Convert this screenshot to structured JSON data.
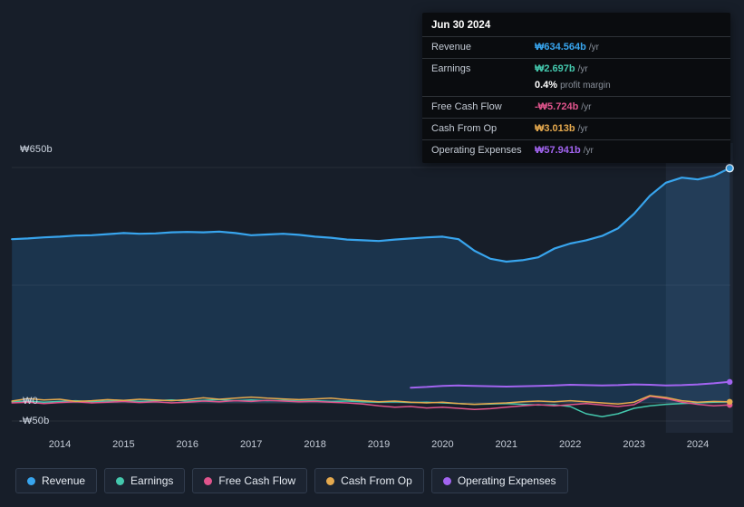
{
  "colors": {
    "revenue": "#38a5ee",
    "earnings": "#44c8ad",
    "free_cash_flow": "#e0548c",
    "cash_from_op": "#e5a94e",
    "operating_expenses": "#a264f0",
    "background": "#171e29",
    "tooltip_bg": "#0a0c0f",
    "grid": "#2a3342"
  },
  "tooltip": {
    "date": "Jun 30 2024",
    "per_year": "/yr",
    "revenue": {
      "label": "Revenue",
      "value": "₩634.564b"
    },
    "earnings": {
      "label": "Earnings",
      "value": "₩2.697b"
    },
    "profit_margin": {
      "value": "0.4%",
      "label": "profit margin"
    },
    "free_cash_flow": {
      "label": "Free Cash Flow",
      "value": "-₩5.724b"
    },
    "cash_from_op": {
      "label": "Cash From Op",
      "value": "₩3.013b"
    },
    "operating_expenses": {
      "label": "Operating Expenses",
      "value": "₩57.941b"
    }
  },
  "axis": {
    "y650": "₩650b",
    "y0": "₩0",
    "yneg50": "-₩50b",
    "x_ticks": [
      {
        "label": "2014",
        "year": 2014
      },
      {
        "label": "2015",
        "year": 2015
      },
      {
        "label": "2016",
        "year": 2016
      },
      {
        "label": "2017",
        "year": 2017
      },
      {
        "label": "2018",
        "year": 2018
      },
      {
        "label": "2019",
        "year": 2019
      },
      {
        "label": "2020",
        "year": 2020
      },
      {
        "label": "2021",
        "year": 2021
      },
      {
        "label": "2022",
        "year": 2022
      },
      {
        "label": "2023",
        "year": 2023
      },
      {
        "label": "2024",
        "year": 2024
      }
    ]
  },
  "legend": [
    {
      "key": "revenue",
      "label": "Revenue"
    },
    {
      "key": "earnings",
      "label": "Earnings"
    },
    {
      "key": "free_cash_flow",
      "label": "Free Cash Flow"
    },
    {
      "key": "cash_from_op",
      "label": "Cash From Op"
    },
    {
      "key": "operating_expenses",
      "label": "Operating Expenses"
    }
  ],
  "chart_data": {
    "type": "area",
    "title": "Revenue & expenses history (KRW billions)",
    "unit": "₩b",
    "ylim": [
      -60,
      680
    ],
    "grid_lines": [
      650,
      325,
      0,
      -50
    ],
    "highlight_from": 2023.5,
    "highlight_to": 2024.55,
    "x": [
      2013.25,
      2013.5,
      2013.75,
      2014,
      2014.25,
      2014.5,
      2014.75,
      2015,
      2015.25,
      2015.5,
      2015.75,
      2016,
      2016.25,
      2016.5,
      2016.75,
      2017,
      2017.25,
      2017.5,
      2017.75,
      2018,
      2018.25,
      2018.5,
      2018.75,
      2019,
      2019.25,
      2019.5,
      2019.75,
      2020,
      2020.25,
      2020.5,
      2020.75,
      2021,
      2021.25,
      2021.5,
      2021.75,
      2022,
      2022.25,
      2022.5,
      2022.75,
      2023,
      2023.25,
      2023.5,
      2023.75,
      2024,
      2024.25,
      2024.5
    ],
    "series": [
      {
        "key": "revenue",
        "name": "Revenue",
        "last_value": 634.564,
        "values": [
          452,
          454,
          457,
          459,
          462,
          463,
          466,
          469,
          467,
          468,
          471,
          472,
          471,
          473,
          469,
          463,
          465,
          467,
          464,
          459,
          456,
          451,
          449,
          447,
          451,
          454,
          457,
          459,
          452,
          420,
          398,
          390,
          394,
          402,
          426,
          440,
          449,
          461,
          482,
          522,
          572,
          608,
          622,
          617,
          627,
          648
        ]
      },
      {
        "key": "earnings",
        "name": "Earnings",
        "last_value": 2.697,
        "values": [
          3,
          5,
          2,
          4,
          6,
          3,
          5,
          7,
          4,
          6,
          8,
          5,
          7,
          9,
          6,
          8,
          6,
          7,
          5,
          6,
          4,
          5,
          3,
          2,
          3,
          1,
          2,
          0,
          -2,
          -4,
          -3,
          -2,
          -4,
          -6,
          -5,
          -10,
          -30,
          -38,
          -30,
          -15,
          -8,
          -4,
          -2,
          0,
          2,
          2.7
        ]
      },
      {
        "key": "free_cash_flow",
        "name": "Free Cash Flow",
        "last_value": -5.724,
        "values": [
          0,
          2,
          -2,
          1,
          3,
          0,
          2,
          4,
          1,
          3,
          0,
          2,
          5,
          3,
          6,
          4,
          7,
          5,
          3,
          4,
          2,
          0,
          -3,
          -8,
          -12,
          -10,
          -14,
          -12,
          -15,
          -18,
          -16,
          -12,
          -8,
          -5,
          -8,
          -5,
          -2,
          -6,
          -10,
          -5,
          18,
          12,
          2,
          -4,
          -8,
          -5.7
        ]
      },
      {
        "key": "cash_from_op",
        "name": "Cash From Op",
        "last_value": 3.013,
        "values": [
          5,
          12,
          8,
          10,
          4,
          6,
          9,
          7,
          10,
          8,
          6,
          9,
          14,
          10,
          13,
          16,
          13,
          11,
          9,
          11,
          13,
          9,
          6,
          3,
          5,
          2,
          0,
          2,
          -2,
          -4,
          -2,
          0,
          3,
          5,
          3,
          6,
          3,
          0,
          -3,
          2,
          20,
          15,
          6,
          2,
          4,
          3
        ]
      },
      {
        "key": "operating_expenses",
        "name": "Operating Expenses",
        "last_value": 57.941,
        "values": [
          null,
          null,
          null,
          null,
          null,
          null,
          null,
          null,
          null,
          null,
          null,
          null,
          null,
          null,
          null,
          null,
          null,
          null,
          null,
          null,
          null,
          null,
          null,
          null,
          null,
          42,
          44,
          47,
          48,
          47,
          46,
          45,
          46,
          47,
          48,
          50,
          49,
          48,
          49,
          51,
          50,
          48,
          49,
          51,
          54,
          57.9
        ]
      }
    ]
  }
}
